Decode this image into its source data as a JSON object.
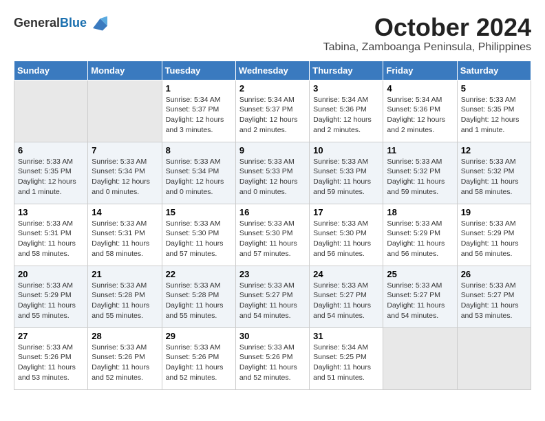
{
  "header": {
    "logo_general": "General",
    "logo_blue": "Blue",
    "month_year": "October 2024",
    "location": "Tabina, Zamboanga Peninsula, Philippines"
  },
  "weekdays": [
    "Sunday",
    "Monday",
    "Tuesday",
    "Wednesday",
    "Thursday",
    "Friday",
    "Saturday"
  ],
  "weeks": [
    [
      {
        "day": "",
        "info": ""
      },
      {
        "day": "",
        "info": ""
      },
      {
        "day": "1",
        "info": "Sunrise: 5:34 AM\nSunset: 5:37 PM\nDaylight: 12 hours\nand 3 minutes."
      },
      {
        "day": "2",
        "info": "Sunrise: 5:34 AM\nSunset: 5:37 PM\nDaylight: 12 hours\nand 2 minutes."
      },
      {
        "day": "3",
        "info": "Sunrise: 5:34 AM\nSunset: 5:36 PM\nDaylight: 12 hours\nand 2 minutes."
      },
      {
        "day": "4",
        "info": "Sunrise: 5:34 AM\nSunset: 5:36 PM\nDaylight: 12 hours\nand 2 minutes."
      },
      {
        "day": "5",
        "info": "Sunrise: 5:33 AM\nSunset: 5:35 PM\nDaylight: 12 hours\nand 1 minute."
      }
    ],
    [
      {
        "day": "6",
        "info": "Sunrise: 5:33 AM\nSunset: 5:35 PM\nDaylight: 12 hours\nand 1 minute."
      },
      {
        "day": "7",
        "info": "Sunrise: 5:33 AM\nSunset: 5:34 PM\nDaylight: 12 hours\nand 0 minutes."
      },
      {
        "day": "8",
        "info": "Sunrise: 5:33 AM\nSunset: 5:34 PM\nDaylight: 12 hours\nand 0 minutes."
      },
      {
        "day": "9",
        "info": "Sunrise: 5:33 AM\nSunset: 5:33 PM\nDaylight: 12 hours\nand 0 minutes."
      },
      {
        "day": "10",
        "info": "Sunrise: 5:33 AM\nSunset: 5:33 PM\nDaylight: 11 hours\nand 59 minutes."
      },
      {
        "day": "11",
        "info": "Sunrise: 5:33 AM\nSunset: 5:32 PM\nDaylight: 11 hours\nand 59 minutes."
      },
      {
        "day": "12",
        "info": "Sunrise: 5:33 AM\nSunset: 5:32 PM\nDaylight: 11 hours\nand 58 minutes."
      }
    ],
    [
      {
        "day": "13",
        "info": "Sunrise: 5:33 AM\nSunset: 5:31 PM\nDaylight: 11 hours\nand 58 minutes."
      },
      {
        "day": "14",
        "info": "Sunrise: 5:33 AM\nSunset: 5:31 PM\nDaylight: 11 hours\nand 58 minutes."
      },
      {
        "day": "15",
        "info": "Sunrise: 5:33 AM\nSunset: 5:30 PM\nDaylight: 11 hours\nand 57 minutes."
      },
      {
        "day": "16",
        "info": "Sunrise: 5:33 AM\nSunset: 5:30 PM\nDaylight: 11 hours\nand 57 minutes."
      },
      {
        "day": "17",
        "info": "Sunrise: 5:33 AM\nSunset: 5:30 PM\nDaylight: 11 hours\nand 56 minutes."
      },
      {
        "day": "18",
        "info": "Sunrise: 5:33 AM\nSunset: 5:29 PM\nDaylight: 11 hours\nand 56 minutes."
      },
      {
        "day": "19",
        "info": "Sunrise: 5:33 AM\nSunset: 5:29 PM\nDaylight: 11 hours\nand 56 minutes."
      }
    ],
    [
      {
        "day": "20",
        "info": "Sunrise: 5:33 AM\nSunset: 5:29 PM\nDaylight: 11 hours\nand 55 minutes."
      },
      {
        "day": "21",
        "info": "Sunrise: 5:33 AM\nSunset: 5:28 PM\nDaylight: 11 hours\nand 55 minutes."
      },
      {
        "day": "22",
        "info": "Sunrise: 5:33 AM\nSunset: 5:28 PM\nDaylight: 11 hours\nand 55 minutes."
      },
      {
        "day": "23",
        "info": "Sunrise: 5:33 AM\nSunset: 5:27 PM\nDaylight: 11 hours\nand 54 minutes."
      },
      {
        "day": "24",
        "info": "Sunrise: 5:33 AM\nSunset: 5:27 PM\nDaylight: 11 hours\nand 54 minutes."
      },
      {
        "day": "25",
        "info": "Sunrise: 5:33 AM\nSunset: 5:27 PM\nDaylight: 11 hours\nand 54 minutes."
      },
      {
        "day": "26",
        "info": "Sunrise: 5:33 AM\nSunset: 5:27 PM\nDaylight: 11 hours\nand 53 minutes."
      }
    ],
    [
      {
        "day": "27",
        "info": "Sunrise: 5:33 AM\nSunset: 5:26 PM\nDaylight: 11 hours\nand 53 minutes."
      },
      {
        "day": "28",
        "info": "Sunrise: 5:33 AM\nSunset: 5:26 PM\nDaylight: 11 hours\nand 52 minutes."
      },
      {
        "day": "29",
        "info": "Sunrise: 5:33 AM\nSunset: 5:26 PM\nDaylight: 11 hours\nand 52 minutes."
      },
      {
        "day": "30",
        "info": "Sunrise: 5:33 AM\nSunset: 5:26 PM\nDaylight: 11 hours\nand 52 minutes."
      },
      {
        "day": "31",
        "info": "Sunrise: 5:34 AM\nSunset: 5:25 PM\nDaylight: 11 hours\nand 51 minutes."
      },
      {
        "day": "",
        "info": ""
      },
      {
        "day": "",
        "info": ""
      }
    ]
  ]
}
